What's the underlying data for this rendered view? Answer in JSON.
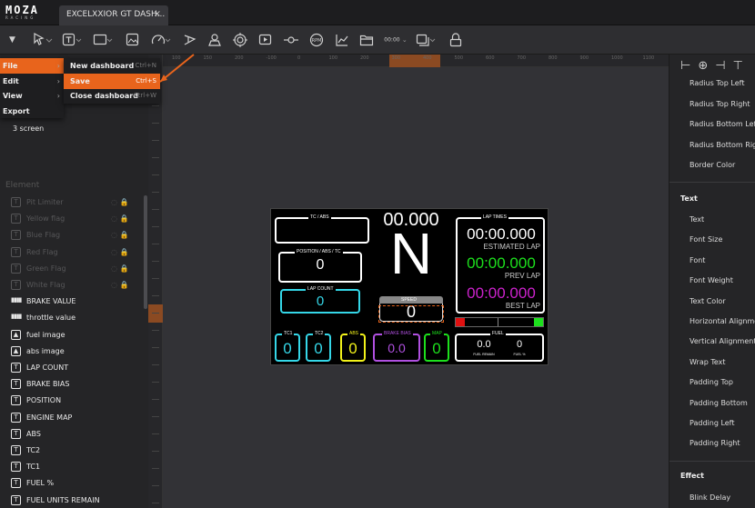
{
  "app": {
    "logo": "MOZA",
    "logo_sub": "RACING",
    "tab_title": "EXCELXXIOR GT DASH...",
    "tab_close": "×"
  },
  "toolbar": {
    "time_format": "00:00"
  },
  "menu": {
    "main": [
      {
        "label": "File",
        "active": true
      },
      {
        "label": "Edit"
      },
      {
        "label": "View"
      },
      {
        "label": "Export"
      }
    ],
    "file_submenu": [
      {
        "label": "New dashboard",
        "shortcut": "Ctrl+N"
      },
      {
        "label": "Save",
        "shortcut": "Ctrl+S",
        "active": true
      },
      {
        "label": "Close dashboard",
        "shortcut": "Ctrl+W"
      }
    ]
  },
  "sidebar": {
    "screen_item": "3 screen",
    "element_title": "Element",
    "elements": [
      {
        "label": "Pit Limiter",
        "icon": "T",
        "hidden": true
      },
      {
        "label": "Yellow flag",
        "icon": "T",
        "hidden": true
      },
      {
        "label": "Blue Flag",
        "icon": "T",
        "hidden": true
      },
      {
        "label": "Red Flag",
        "icon": "T",
        "hidden": true
      },
      {
        "label": "Green Flag",
        "icon": "T",
        "hidden": true
      },
      {
        "label": "White Flag",
        "icon": "T",
        "hidden": true
      },
      {
        "label": "BRAKE VALUE",
        "icon": "bars"
      },
      {
        "label": "throttle value",
        "icon": "bars"
      },
      {
        "label": "fuel image",
        "icon": "img"
      },
      {
        "label": "abs image",
        "icon": "img"
      },
      {
        "label": "LAP COUNT",
        "icon": "T"
      },
      {
        "label": "BRAKE BIAS",
        "icon": "T"
      },
      {
        "label": "POSITION",
        "icon": "T"
      },
      {
        "label": "ENGINE MAP",
        "icon": "T"
      },
      {
        "label": "ABS",
        "icon": "T"
      },
      {
        "label": "TC2",
        "icon": "T"
      },
      {
        "label": "TC1",
        "icon": "T"
      },
      {
        "label": "FUEL %",
        "icon": "T"
      },
      {
        "label": "FUEL UNITS REMAIN",
        "icon": "T"
      }
    ]
  },
  "ruler": {
    "h_labels": [
      "100",
      "150",
      "200",
      "-100",
      "0",
      "100",
      "200",
      "300",
      "400",
      "500",
      "600",
      "700",
      "800",
      "900",
      "1000",
      "1100",
      "1200"
    ]
  },
  "right_panel": {
    "top_props": [
      "Radius Top Left",
      "Radius Top Right",
      "Radius Bottom Left",
      "Radius Bottom Right",
      "Border Color"
    ],
    "text_section": "Text",
    "text_props": [
      "Text",
      "Font Size",
      "Font",
      "Font Weight",
      "Text Color",
      "Horizontal Alignment",
      "Vertical Alignment",
      "Wrap Text",
      "Padding Top",
      "Padding Bottom",
      "Padding Left",
      "Padding Right"
    ],
    "effect_section": "Effect",
    "effect_props": [
      "Blink Delay"
    ]
  },
  "dashboard": {
    "tc_abs_label": "TC / ABS",
    "speed_top": "00.000",
    "gear": "N",
    "position_label": "POSITION / ABS / TC",
    "position_value": "0",
    "lap_count_label": "LAP COUNT",
    "lap_count_value": "0",
    "speed_label": "SPEED",
    "speed_value": "0",
    "lap_times_label": "LAP TIMES",
    "estimated_lap_time": "00:00.000",
    "estimated_lap_label": "ESTIMATED LAP",
    "prev_lap_time": "00:00.000",
    "prev_lap_label": "PREV LAP",
    "best_lap_time": "00:00.000",
    "best_lap_label": "BEST LAP",
    "tc1_label": "TC1",
    "tc1_value": "0",
    "tc2_label": "TC2",
    "tc2_value": "0",
    "abs_label": "ABS",
    "abs_value": "0",
    "brake_bias_label": "BRAKE BIAS",
    "brake_bias_value": "0.0",
    "map_label": "MAP",
    "map_value": "0",
    "fuel_label": "FUEL",
    "fuel_remain_value": "0.0",
    "fuel_remain_label": "FUEL REMAIN",
    "fuel_pct_value": "0",
    "fuel_pct_label": "FUEL %",
    "colors": {
      "cyan": "#35d7e8",
      "green": "#1de01d",
      "yellow": "#f2f21a",
      "magenta": "#cc22cc",
      "purple": "#b050e0",
      "red": "#e01010"
    }
  }
}
